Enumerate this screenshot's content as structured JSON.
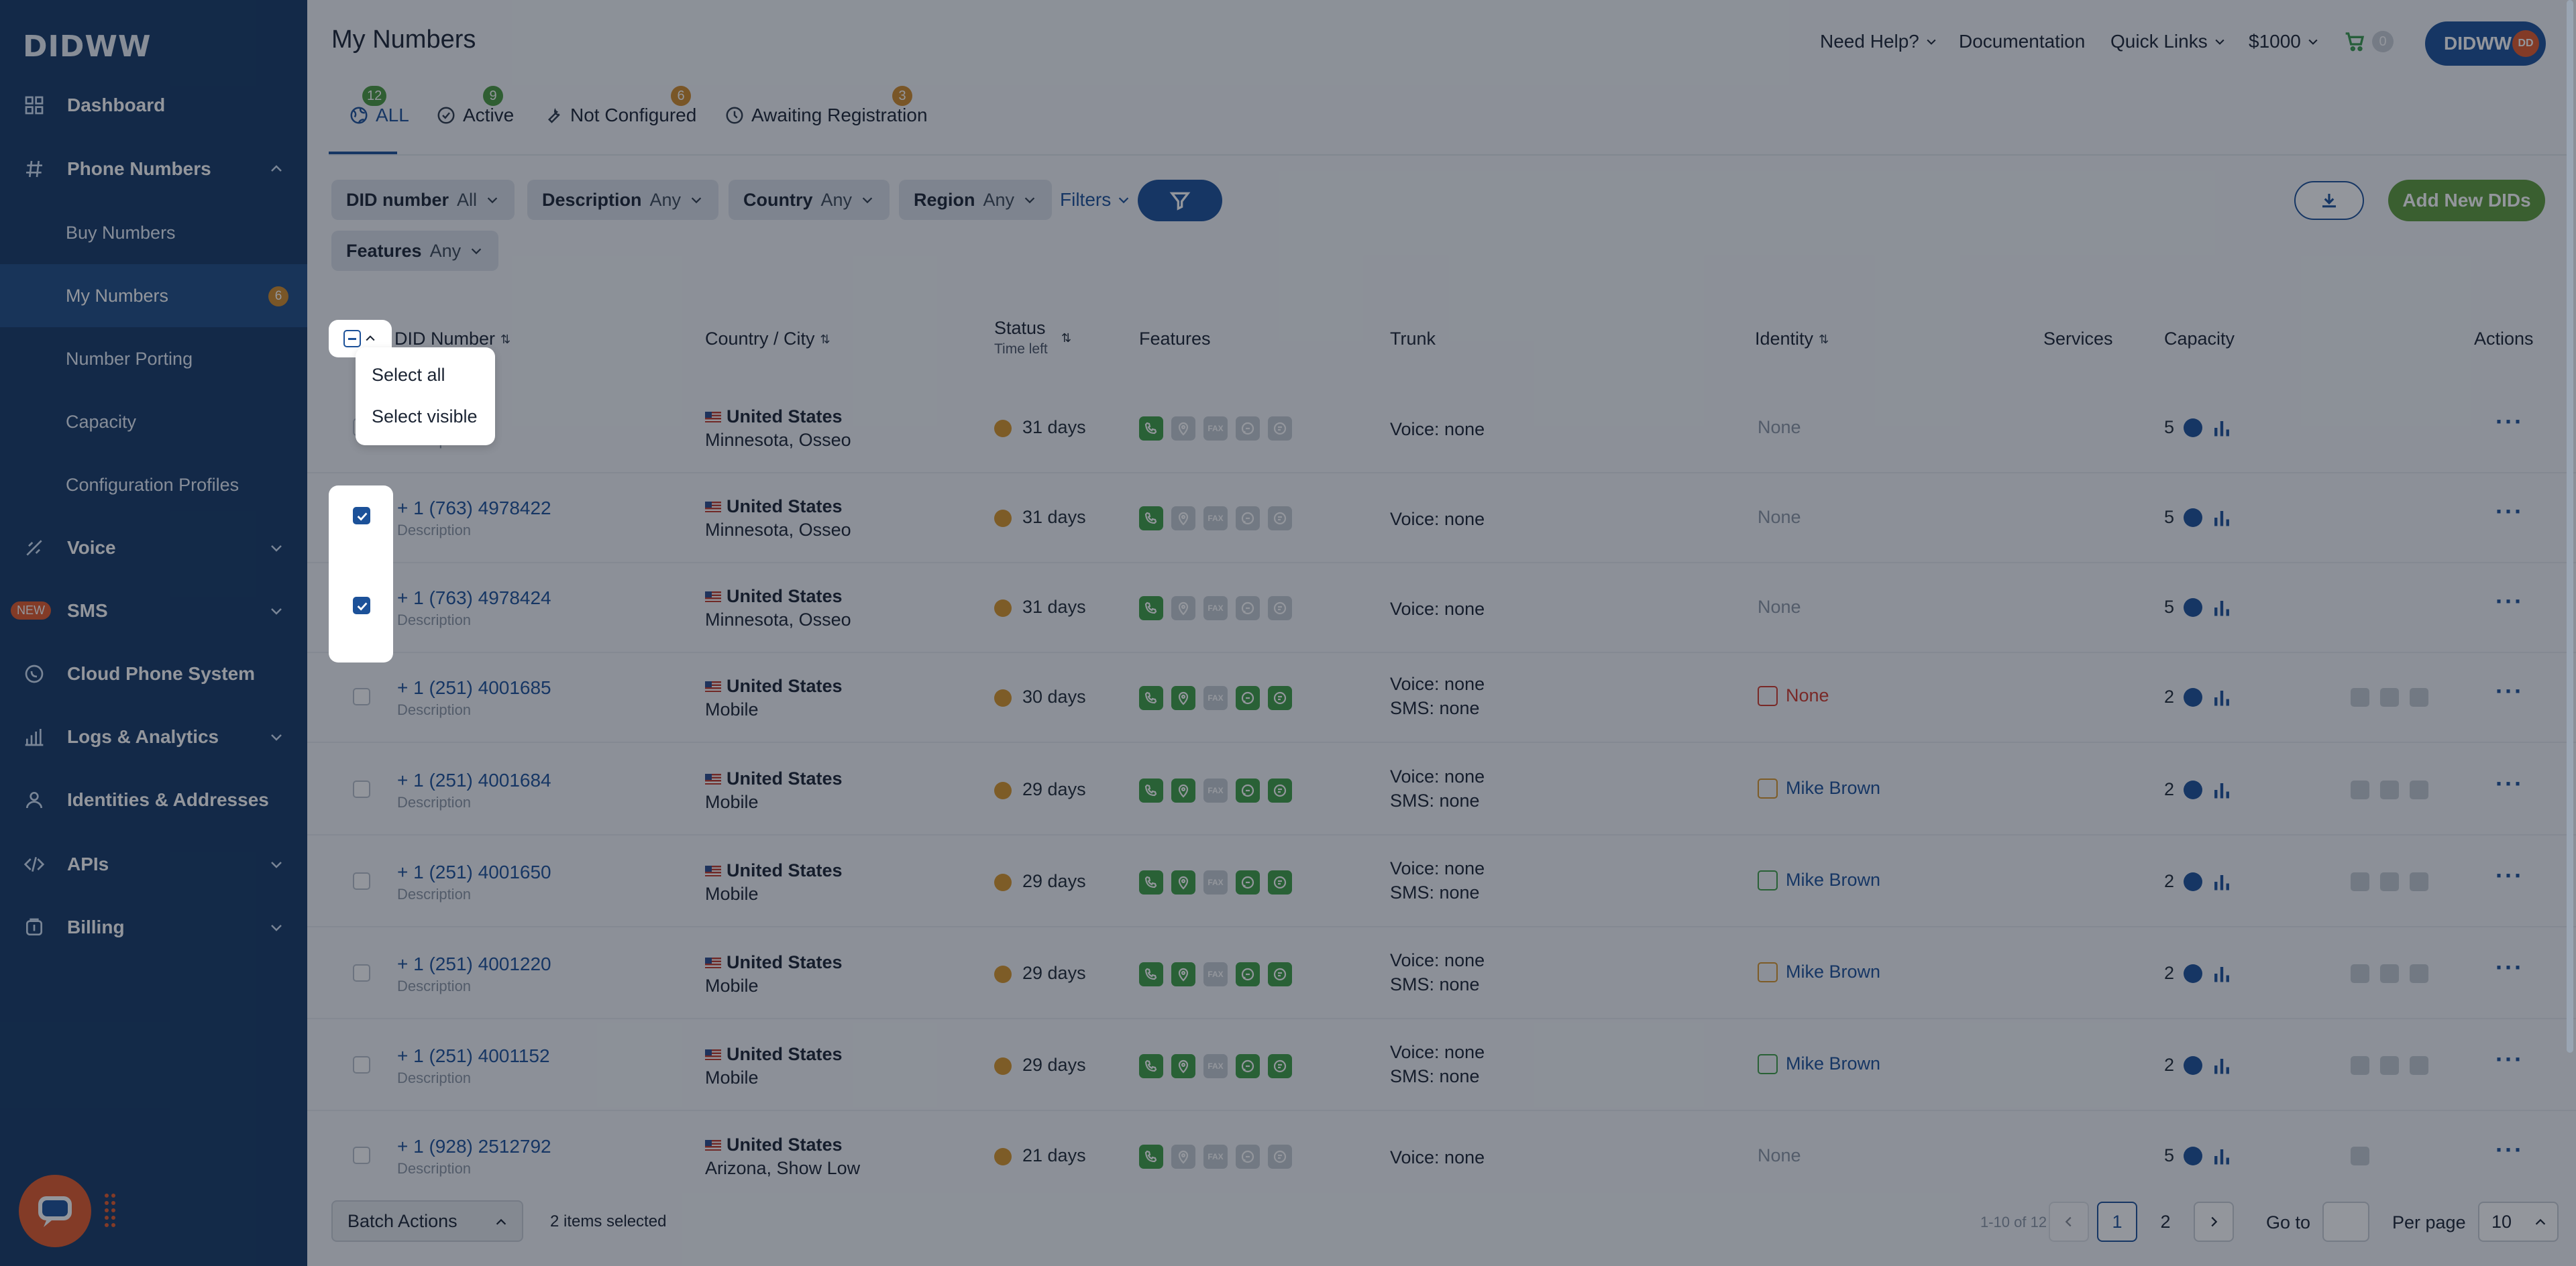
{
  "app": {
    "logo": "DIDWW"
  },
  "sidebar": {
    "items": [
      {
        "label": "Dashboard"
      },
      {
        "label": "Phone Numbers"
      },
      {
        "label": "Voice"
      },
      {
        "label": "SMS",
        "badge": "NEW"
      },
      {
        "label": "Cloud Phone System"
      },
      {
        "label": "Logs & Analytics"
      },
      {
        "label": "Identities & Addresses"
      },
      {
        "label": "APIs"
      },
      {
        "label": "Billing"
      }
    ],
    "sub_items": [
      {
        "label": "Buy Numbers"
      },
      {
        "label": "My Numbers",
        "badge": "6"
      },
      {
        "label": "Number Porting"
      },
      {
        "label": "Capacity"
      },
      {
        "label": "Configuration Profiles"
      }
    ]
  },
  "header": {
    "title": "My Numbers",
    "need_help": "Need Help?",
    "documentation": "Documentation",
    "quick_links": "Quick Links",
    "balance": "$1000",
    "cart_count": "0",
    "user": "DIDWW",
    "avatar": "DD"
  },
  "tabs": [
    {
      "label": "ALL",
      "count": "12",
      "color": "#4a9a3e"
    },
    {
      "label": "Active",
      "count": "9",
      "color": "#4a9a3e"
    },
    {
      "label": "Not Configured",
      "count": "6",
      "color": "#d08a2a"
    },
    {
      "label": "Awaiting Registration",
      "count": "3",
      "color": "#d08a2a"
    }
  ],
  "filters": {
    "did": {
      "label": "DID number",
      "value": "All"
    },
    "description": {
      "label": "Description",
      "value": "Any"
    },
    "country": {
      "label": "Country",
      "value": "Any"
    },
    "region": {
      "label": "Region",
      "value": "Any"
    },
    "features": {
      "label": "Features",
      "value": "Any"
    },
    "more": "Filters",
    "add_button": "Add New DIDs"
  },
  "table": {
    "headers": {
      "did": "DID Number",
      "country": "Country / City",
      "status": "Status",
      "time_left": "Time left",
      "features": "Features",
      "trunk": "Trunk",
      "identity": "Identity",
      "services": "Services",
      "capacity": "Capacity",
      "actions": "Actions"
    },
    "rows": [
      {
        "did": "+ 1 (763) 4977780",
        "did_visible": "77780",
        "desc": "Description",
        "country": "United States",
        "city": "Minnesota, Osseo",
        "days": "31 days",
        "trunk1": "Voice: none",
        "trunk2": "",
        "identity": "None",
        "identity_type": "none",
        "capacity": "5",
        "checked": false,
        "feats": [
          1,
          0,
          0,
          0,
          0
        ],
        "services": 0
      },
      {
        "did": "+ 1 (763) 4978422",
        "desc": "Description",
        "country": "United States",
        "city": "Minnesota, Osseo",
        "days": "31 days",
        "trunk1": "Voice: none",
        "trunk2": "",
        "identity": "None",
        "identity_type": "none",
        "capacity": "5",
        "checked": true,
        "feats": [
          1,
          0,
          0,
          0,
          0
        ],
        "services": 0
      },
      {
        "did": "+ 1 (763) 4978424",
        "desc": "Description",
        "country": "United States",
        "city": "Minnesota, Osseo",
        "days": "31 days",
        "trunk1": "Voice: none",
        "trunk2": "",
        "identity": "None",
        "identity_type": "none",
        "capacity": "5",
        "checked": true,
        "feats": [
          1,
          0,
          0,
          0,
          0
        ],
        "services": 0
      },
      {
        "did": "+ 1 (251) 4001685",
        "desc": "Description",
        "country": "United States",
        "city": "Mobile",
        "days": "30 days",
        "trunk1": "Voice: none",
        "trunk2": "SMS: none",
        "identity": "None",
        "identity_type": "red",
        "capacity": "2",
        "checked": false,
        "feats": [
          1,
          1,
          0,
          1,
          1
        ],
        "services": 3
      },
      {
        "did": "+ 1 (251) 4001684",
        "desc": "Description",
        "country": "United States",
        "city": "Mobile",
        "days": "29 days",
        "trunk1": "Voice: none",
        "trunk2": "SMS: none",
        "identity": "Mike Brown",
        "identity_type": "orange",
        "capacity": "2",
        "checked": false,
        "feats": [
          1,
          1,
          0,
          1,
          1
        ],
        "services": 3
      },
      {
        "did": "+ 1 (251) 4001650",
        "desc": "Description",
        "country": "United States",
        "city": "Mobile",
        "days": "29 days",
        "trunk1": "Voice: none",
        "trunk2": "SMS: none",
        "identity": "Mike Brown",
        "identity_type": "green",
        "capacity": "2",
        "checked": false,
        "feats": [
          1,
          1,
          0,
          1,
          1
        ],
        "services": 3
      },
      {
        "did": "+ 1 (251) 4001220",
        "desc": "Description",
        "country": "United States",
        "city": "Mobile",
        "days": "29 days",
        "trunk1": "Voice: none",
        "trunk2": "SMS: none",
        "identity": "Mike Brown",
        "identity_type": "orange",
        "capacity": "2",
        "checked": false,
        "feats": [
          1,
          1,
          0,
          1,
          1
        ],
        "services": 3
      },
      {
        "did": "+ 1 (251) 4001152",
        "desc": "Description",
        "country": "United States",
        "city": "Mobile",
        "days": "29 days",
        "trunk1": "Voice: none",
        "trunk2": "SMS: none",
        "identity": "Mike Brown",
        "identity_type": "green",
        "capacity": "2",
        "checked": false,
        "feats": [
          1,
          1,
          0,
          1,
          1
        ],
        "services": 3
      },
      {
        "did": "+ 1 (928) 2512792",
        "desc": "Description",
        "country": "United States",
        "city": "Arizona, Show Low",
        "days": "21 days",
        "trunk1": "Voice: none",
        "trunk2": "",
        "identity": "None",
        "identity_type": "none",
        "capacity": "5",
        "checked": false,
        "feats": [
          1,
          0,
          0,
          0,
          0
        ],
        "services": 1
      }
    ]
  },
  "select_menu": {
    "select_all": "Select all",
    "select_visible": "Select visible"
  },
  "footer": {
    "batch_actions": "Batch Actions",
    "selected": "2 items selected",
    "range": "1-10 of 12",
    "page1": "1",
    "page2": "2",
    "goto": "Go to",
    "per_page": "Per page",
    "per_page_value": "10"
  }
}
